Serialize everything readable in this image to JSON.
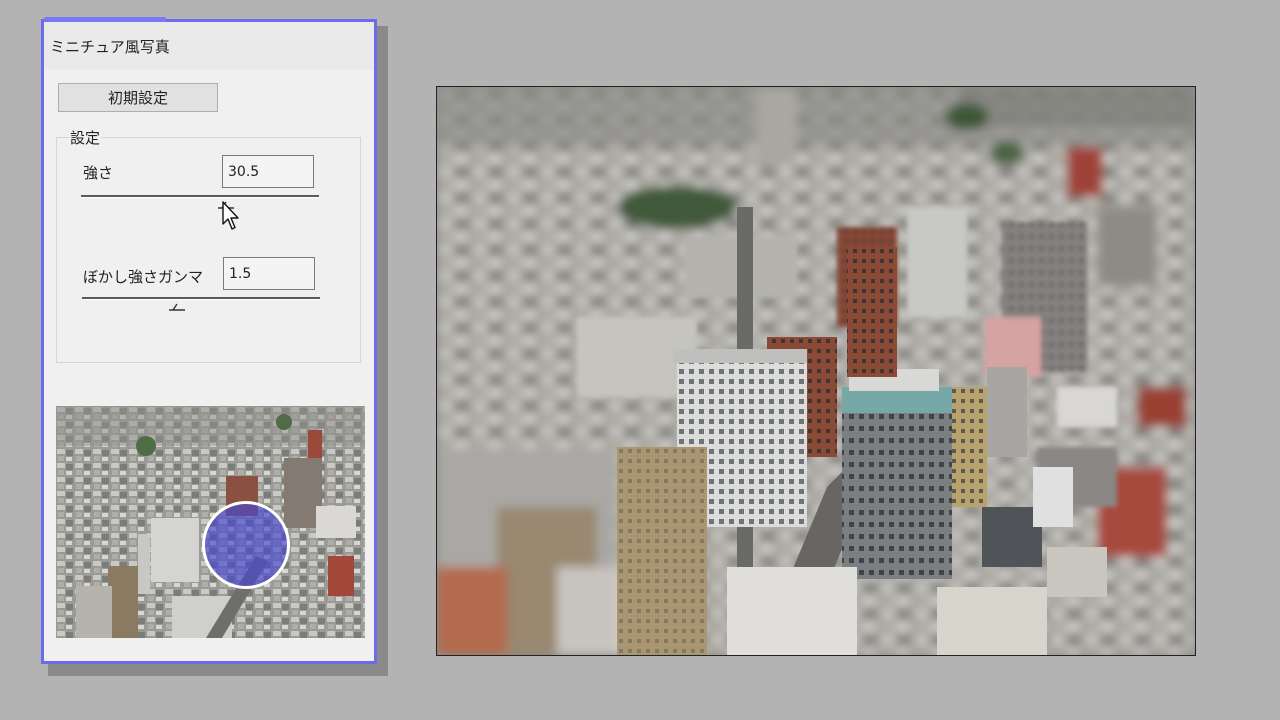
{
  "window": {
    "title": "ミニチュア風写真"
  },
  "buttons": {
    "reset_label": "初期設定"
  },
  "settings": {
    "group_label": "設定",
    "strength": {
      "label": "強さ",
      "value": "30.5",
      "slider_position": 0.61
    },
    "blur_gamma": {
      "label": "ぼかし強さガンマ",
      "value": "1.5",
      "slider_position": 0.4
    }
  },
  "preview": {
    "focus_circle_color": "#4646d2"
  },
  "colors": {
    "dialog_border": "#6b6bf0",
    "background": "#b3b3b3"
  },
  "icons": {
    "cursor": "arrow-cursor-icon"
  }
}
